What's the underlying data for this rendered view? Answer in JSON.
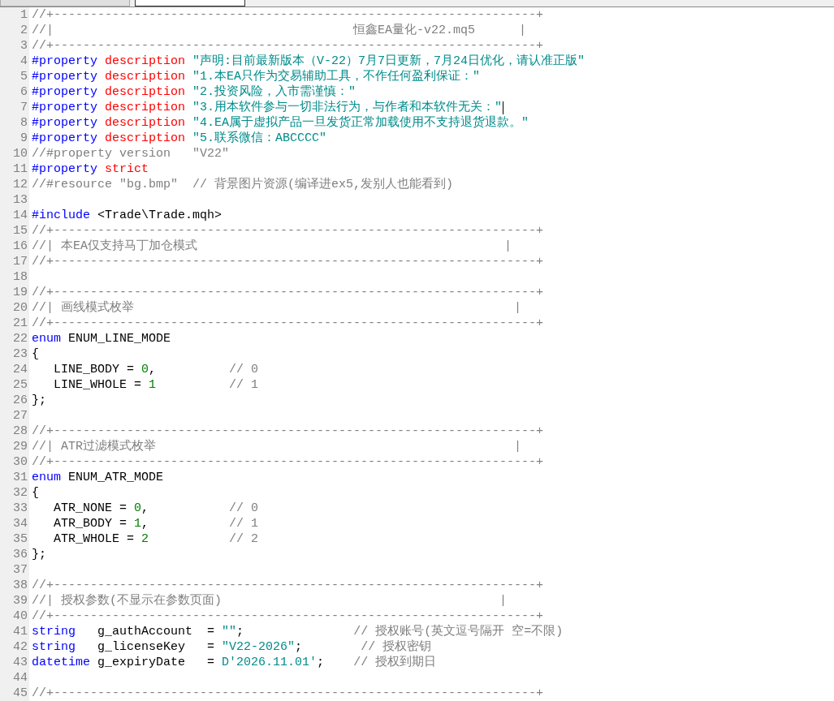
{
  "tabs": [
    {
      "selected": false
    },
    {
      "selected": true
    }
  ],
  "lines": [
    {
      "number": "1",
      "tokens": [
        {
          "kind": "comment",
          "text": "//+------------------------------------------------------------------+"
        }
      ]
    },
    {
      "number": "2",
      "tokens": [
        {
          "kind": "comment",
          "text": "//|                                         恒鑫EA量化-v22.mq5      |"
        }
      ]
    },
    {
      "number": "3",
      "tokens": [
        {
          "kind": "comment",
          "text": "//+------------------------------------------------------------------+"
        }
      ]
    },
    {
      "number": "4",
      "tokens": [
        {
          "kind": "keyword",
          "text": "#property"
        },
        {
          "kind": "property",
          "text": " description"
        },
        {
          "kind": "string",
          "text": " \"声明:目前最新版本（V-22）7月7日更新，7月24日优化，请认准正版\""
        }
      ]
    },
    {
      "number": "5",
      "tokens": [
        {
          "kind": "keyword",
          "text": "#property"
        },
        {
          "kind": "property",
          "text": " description"
        },
        {
          "kind": "string",
          "text": " \"1.本EA只作为交易辅助工具，不作任何盈利保证：\""
        }
      ]
    },
    {
      "number": "6",
      "tokens": [
        {
          "kind": "keyword",
          "text": "#property"
        },
        {
          "kind": "property",
          "text": " description"
        },
        {
          "kind": "string",
          "text": " \"2.投资风险，入市需谨慎：\""
        }
      ]
    },
    {
      "number": "7",
      "tokens": [
        {
          "kind": "keyword",
          "text": "#property"
        },
        {
          "kind": "property",
          "text": " description"
        },
        {
          "kind": "string",
          "text": " \"3.用本软件参与一切非法行为，与作者和本软件无关：\""
        },
        {
          "kind": "caret"
        }
      ]
    },
    {
      "number": "8",
      "tokens": [
        {
          "kind": "keyword",
          "text": "#property"
        },
        {
          "kind": "property",
          "text": " description"
        },
        {
          "kind": "string",
          "text": " \"4.EA属于虚拟产品一旦发货正常加载使用不支持退货退款。\""
        }
      ]
    },
    {
      "number": "9",
      "tokens": [
        {
          "kind": "keyword",
          "text": "#property"
        },
        {
          "kind": "property",
          "text": " description"
        },
        {
          "kind": "string",
          "text": " \"5.联系微信：ABCCCC\""
        }
      ]
    },
    {
      "number": "10",
      "tokens": [
        {
          "kind": "comment",
          "text": "//#property version   \"V22\""
        }
      ]
    },
    {
      "number": "11",
      "tokens": [
        {
          "kind": "keyword",
          "text": "#property"
        },
        {
          "kind": "property",
          "text": " strict"
        }
      ]
    },
    {
      "number": "12",
      "tokens": [
        {
          "kind": "comment",
          "text": "//#resource \"bg.bmp\"  // 背景图片资源(编译进ex5,发别人也能看到)"
        }
      ]
    },
    {
      "number": "13"
    },
    {
      "number": "14",
      "tokens": [
        {
          "kind": "keyword",
          "text": "#include"
        },
        {
          "kind": "plain",
          "text": " <Trade\\Trade.mqh>"
        }
      ]
    },
    {
      "number": "15",
      "tokens": [
        {
          "kind": "comment",
          "text": "//+------------------------------------------------------------------+"
        }
      ]
    },
    {
      "number": "16",
      "tokens": [
        {
          "kind": "comment",
          "text": "//| 本EA仅支持马丁加仓模式                                          |"
        }
      ]
    },
    {
      "number": "17",
      "tokens": [
        {
          "kind": "comment",
          "text": "//+------------------------------------------------------------------+"
        }
      ]
    },
    {
      "number": "18"
    },
    {
      "number": "19",
      "tokens": [
        {
          "kind": "comment",
          "text": "//+------------------------------------------------------------------+"
        }
      ]
    },
    {
      "number": "20",
      "tokens": [
        {
          "kind": "comment",
          "text": "//| 画线模式枚举                                                    |"
        }
      ]
    },
    {
      "number": "21",
      "tokens": [
        {
          "kind": "comment",
          "text": "//+------------------------------------------------------------------+"
        }
      ]
    },
    {
      "number": "22",
      "tokens": [
        {
          "kind": "keyword",
          "text": "enum"
        },
        {
          "kind": "plain",
          "text": " ENUM_LINE_MODE"
        }
      ]
    },
    {
      "number": "23",
      "tokens": [
        {
          "kind": "plain",
          "text": "{"
        }
      ]
    },
    {
      "number": "24",
      "tokens": [
        {
          "kind": "plain",
          "text": "   LINE_BODY = "
        },
        {
          "kind": "number",
          "text": "0"
        },
        {
          "kind": "plain",
          "text": ","
        },
        {
          "kind": "comment",
          "text": "          // 0"
        }
      ]
    },
    {
      "number": "25",
      "tokens": [
        {
          "kind": "plain",
          "text": "   LINE_WHOLE = "
        },
        {
          "kind": "number",
          "text": "1"
        },
        {
          "kind": "comment",
          "text": "          // 1"
        }
      ]
    },
    {
      "number": "26",
      "tokens": [
        {
          "kind": "plain",
          "text": "};"
        }
      ]
    },
    {
      "number": "27"
    },
    {
      "number": "28",
      "tokens": [
        {
          "kind": "comment",
          "text": "//+------------------------------------------------------------------+"
        }
      ]
    },
    {
      "number": "29",
      "tokens": [
        {
          "kind": "comment",
          "text": "//| ATR过滤模式枚举                                                 |"
        }
      ]
    },
    {
      "number": "30",
      "tokens": [
        {
          "kind": "comment",
          "text": "//+------------------------------------------------------------------+"
        }
      ]
    },
    {
      "number": "31",
      "tokens": [
        {
          "kind": "keyword",
          "text": "enum"
        },
        {
          "kind": "plain",
          "text": " ENUM_ATR_MODE"
        }
      ]
    },
    {
      "number": "32",
      "tokens": [
        {
          "kind": "plain",
          "text": "{"
        }
      ]
    },
    {
      "number": "33",
      "tokens": [
        {
          "kind": "plain",
          "text": "   ATR_NONE = "
        },
        {
          "kind": "number",
          "text": "0"
        },
        {
          "kind": "plain",
          "text": ","
        },
        {
          "kind": "comment",
          "text": "           // 0"
        }
      ]
    },
    {
      "number": "34",
      "tokens": [
        {
          "kind": "plain",
          "text": "   ATR_BODY = "
        },
        {
          "kind": "number",
          "text": "1"
        },
        {
          "kind": "plain",
          "text": ","
        },
        {
          "kind": "comment",
          "text": "           // 1"
        }
      ]
    },
    {
      "number": "35",
      "tokens": [
        {
          "kind": "plain",
          "text": "   ATR_WHOLE = "
        },
        {
          "kind": "number",
          "text": "2"
        },
        {
          "kind": "comment",
          "text": "           // 2"
        }
      ]
    },
    {
      "number": "36",
      "tokens": [
        {
          "kind": "plain",
          "text": "};"
        }
      ]
    },
    {
      "number": "37"
    },
    {
      "number": "38",
      "tokens": [
        {
          "kind": "comment",
          "text": "//+------------------------------------------------------------------+"
        }
      ]
    },
    {
      "number": "39",
      "tokens": [
        {
          "kind": "comment",
          "text": "//| 授权参数(不显示在参数页面)                                      |"
        }
      ]
    },
    {
      "number": "40",
      "tokens": [
        {
          "kind": "comment",
          "text": "//+------------------------------------------------------------------+"
        }
      ]
    },
    {
      "number": "41",
      "tokens": [
        {
          "kind": "keyword",
          "text": "string"
        },
        {
          "kind": "plain",
          "text": "   g_authAccount  ="
        },
        {
          "kind": "string",
          "text": " \"\""
        },
        {
          "kind": "plain",
          "text": ";"
        },
        {
          "kind": "comment",
          "text": "               // 授权账号(英文逗号隔开 空=不限)"
        }
      ]
    },
    {
      "number": "42",
      "tokens": [
        {
          "kind": "keyword",
          "text": "string"
        },
        {
          "kind": "plain",
          "text": "   g_licenseKey   ="
        },
        {
          "kind": "string",
          "text": " \"V22-2026\""
        },
        {
          "kind": "plain",
          "text": ";"
        },
        {
          "kind": "comment",
          "text": "        // 授权密钥"
        }
      ]
    },
    {
      "number": "43",
      "tokens": [
        {
          "kind": "keyword",
          "text": "datetime"
        },
        {
          "kind": "plain",
          "text": " g_expiryDate   ="
        },
        {
          "kind": "string",
          "text": " D'2026.11.01'"
        },
        {
          "kind": "plain",
          "text": ";"
        },
        {
          "kind": "comment",
          "text": "    // 授权到期日"
        }
      ]
    },
    {
      "number": "44"
    },
    {
      "number": "45",
      "tokens": [
        {
          "kind": "comment",
          "text": "//+------------------------------------------------------------------+"
        }
      ]
    }
  ]
}
